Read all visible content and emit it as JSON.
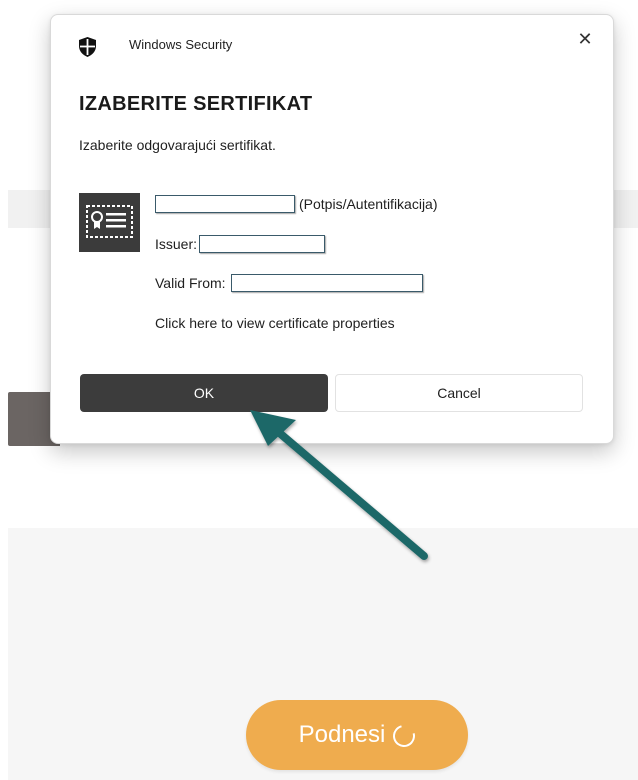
{
  "dialog": {
    "app_title": "Windows Security",
    "heading": "IZABERITE SERTIFIKAT",
    "subtitle": "Izaberite odgovarajući sertifikat.",
    "certificate": {
      "name_suffix": "(Potpis/Autentifikacija)",
      "issuer_label": "Issuer:",
      "valid_from_label": "Valid From:",
      "properties_link": "Click here to view certificate properties"
    },
    "ok_label": "OK",
    "cancel_label": "Cancel"
  },
  "page": {
    "submit_label": "Podnesi"
  },
  "colors": {
    "submit_button": "#efac4e",
    "annotation_arrow": "#1f6767",
    "ok_button": "#3c3c3c"
  },
  "icons": [
    "shield-icon",
    "close-icon",
    "certificate-icon",
    "spinner-icon",
    "annotation-arrow"
  ]
}
